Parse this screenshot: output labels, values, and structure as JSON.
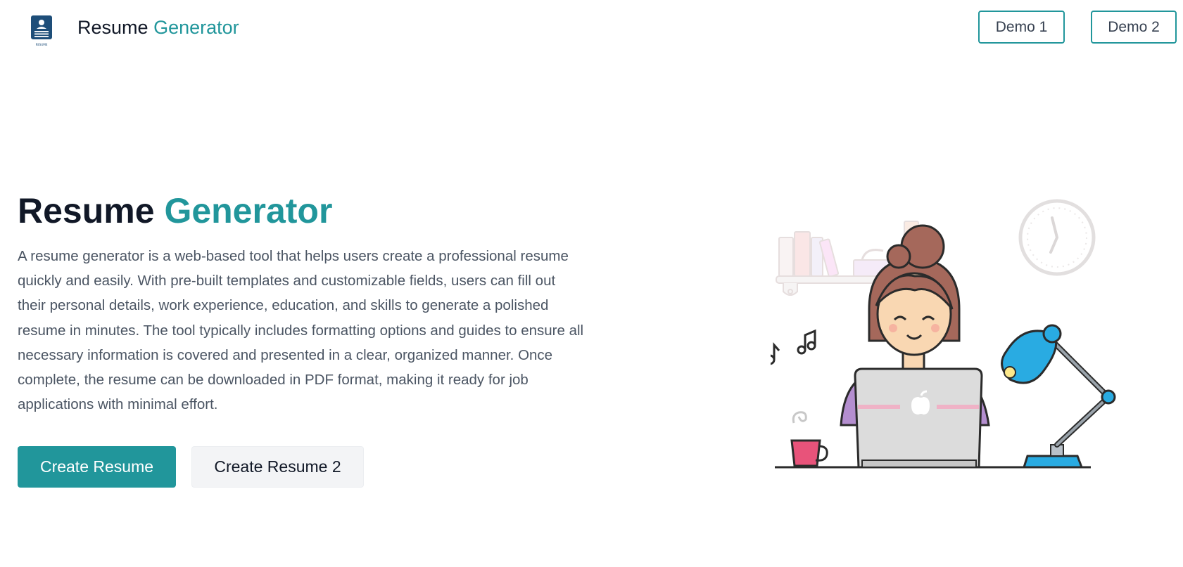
{
  "header": {
    "logo_icon": "resume-document-icon",
    "logo_caption": "RESUME",
    "brand_part1": "Resume",
    "brand_part2": "Generator",
    "demo1_label": "Demo 1",
    "demo2_label": "Demo 2"
  },
  "hero": {
    "title_part1": "Resume",
    "title_part2": "Generator",
    "description_lines": [
      "A resume generator is a web-based tool that helps users create a professional resume",
      "quickly and easily. With pre-built templates and customizable fields, users can fill out",
      "their personal details, work experience, education, and skills to generate a polished",
      "resume in minutes. The tool typically includes formatting options and guides to ensure all",
      "necessary information is covered and presented in a clear, organized manner. Once",
      "complete, the resume can be downloaded in PDF format, making it ready for job",
      "applications with minimal effort."
    ],
    "primary_button": "Create Resume",
    "secondary_button": "Create Resume 2"
  },
  "illustration": {
    "subject": "woman-working-on-laptop-illustration"
  },
  "colors": {
    "accent": "#21969b",
    "text_dark": "#111827",
    "text_muted": "#4b5563",
    "secondary_bg": "#f3f4f6",
    "lamp_blue": "#29abe2",
    "cup_pink": "#e8537a",
    "logo_navy": "#1e4e79"
  }
}
